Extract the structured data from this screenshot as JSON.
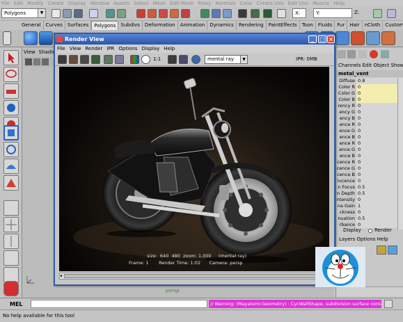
{
  "main_menu": [
    "File",
    "Edit",
    "Modify",
    "Create",
    "Display",
    "Window",
    "Assets",
    "Select",
    "Mesh",
    "Edit Mesh",
    "Proxy",
    "Normals",
    "Color",
    "Create UVs",
    "Edit UVs",
    "Muscle",
    "Help"
  ],
  "status_line": {
    "menu_set": "Polygons",
    "x_label": "X:",
    "y_label": "Y:",
    "z_label": "Z:"
  },
  "shelf_tabs": [
    "General",
    "Curves",
    "Surfaces",
    "Polygons",
    "Subdivs",
    "Deformation",
    "Animation",
    "Dynamics",
    "Rendering",
    "PaintEffects",
    "Toon",
    "Fluids",
    "Fur",
    "Hair",
    "nCloth",
    "Custom"
  ],
  "shelf_active_tab": "Polygons",
  "viewport": {
    "menu": [
      "View",
      "Shading"
    ],
    "camera_caption": "persp"
  },
  "render_view": {
    "title": "Render View",
    "menu": [
      "File",
      "View",
      "Render",
      "IPR",
      "Options",
      "Display",
      "Help"
    ],
    "ratio_label": "1:1",
    "renderer": "mental ray",
    "ipr_status": "IPR: 0MB",
    "info_line1": "size:  640  480  zoom: 1.000     (mental ray)",
    "info_line2": "Frame: 1       Render Time: 1:02      Camera: persp"
  },
  "channel_box": {
    "header": [
      "Channels",
      "Edit",
      "Object",
      "Show"
    ],
    "object_name": "metal_vent",
    "attributes": [
      {
        "label": "Diffuse",
        "value": "0.8",
        "hl": false
      },
      {
        "label": "Color R",
        "value": "0",
        "hl": true
      },
      {
        "label": "Color G",
        "value": "0",
        "hl": true
      },
      {
        "label": "Color B",
        "value": "0",
        "hl": true
      },
      {
        "label": "rency R",
        "value": "0",
        "hl": false
      },
      {
        "label": "ency G",
        "value": "0",
        "hl": false
      },
      {
        "label": "ency B",
        "value": "0",
        "hl": false
      },
      {
        "label": "ence R",
        "value": "0",
        "hl": false
      },
      {
        "label": "ence G",
        "value": "0",
        "hl": false
      },
      {
        "label": "ence B",
        "value": "0",
        "hl": false
      },
      {
        "label": "ence R",
        "value": "0",
        "hl": false
      },
      {
        "label": "ence G",
        "value": "0",
        "hl": false
      },
      {
        "label": "ence B",
        "value": "0",
        "hl": false
      },
      {
        "label": "cence R",
        "value": "0",
        "hl": false
      },
      {
        "label": "cence G",
        "value": "0",
        "hl": false
      },
      {
        "label": "cence B",
        "value": "0",
        "hl": false
      },
      {
        "label": "lucence",
        "value": "0",
        "hl": false
      },
      {
        "label": "n Focus",
        "value": "0.5",
        "hl": false
      },
      {
        "label": "n Depth",
        "value": "0.5",
        "hl": false
      },
      {
        "label": "ntensity",
        "value": "0",
        "hl": false
      },
      {
        "label": "na Gain",
        "value": "1",
        "hl": false
      },
      {
        "label": "ckness",
        "value": "0",
        "hl": false
      },
      {
        "label": "nuation",
        "value": "0.5",
        "hl": false
      },
      {
        "label": "rbance",
        "value": "0",
        "hl": false
      }
    ],
    "layer_tabs": [
      "Display",
      "Render"
    ],
    "layer_menu": [
      "Layers",
      "Options",
      "Help"
    ]
  },
  "command_line": {
    "label": "MEL",
    "warning": "// Warning: (Mayatomr.Geometry) : CycWallShape, subdivision surface contains creas"
  },
  "help_line": "No help available for this tool"
}
